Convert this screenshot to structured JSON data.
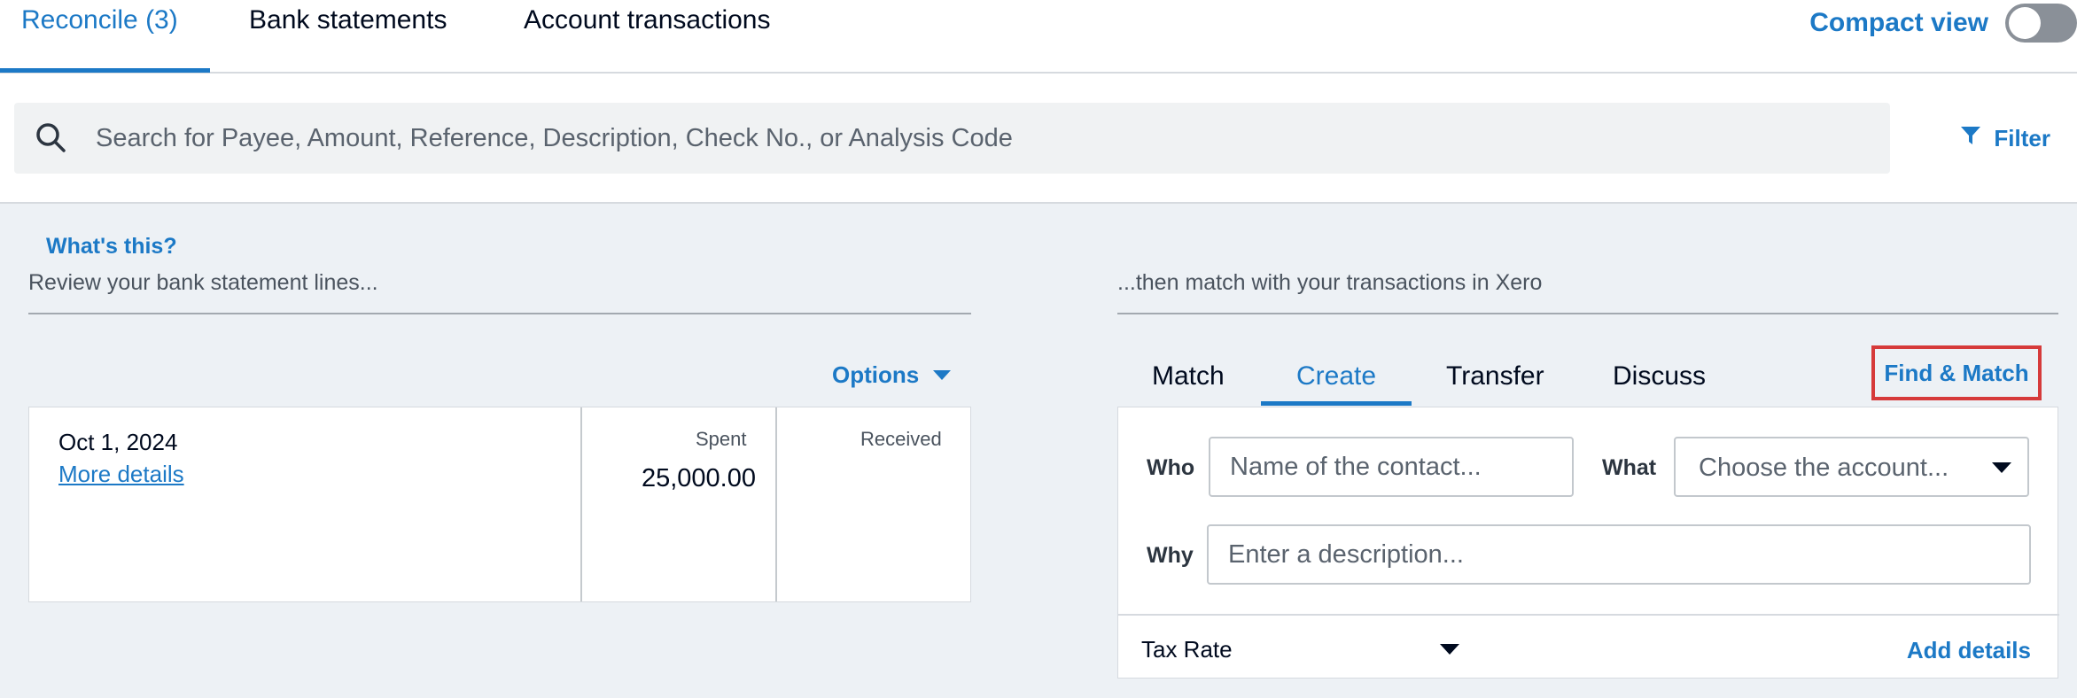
{
  "top_tabs": [
    {
      "label": "Reconcile (3)",
      "active": true
    },
    {
      "label": "Bank statements",
      "active": false
    },
    {
      "label": "Account transactions",
      "active": false
    }
  ],
  "compact_view": {
    "label": "Compact view",
    "enabled": false
  },
  "search": {
    "placeholder": "Search for Payee, Amount, Reference, Description, Check No., or Analysis Code",
    "icon": "search-icon"
  },
  "filter": {
    "label": "Filter",
    "icon": "funnel-icon"
  },
  "help": {
    "whats_this": "What's this?"
  },
  "captions": {
    "left": "Review your bank statement lines...",
    "right": "...then match with your transactions in Xero"
  },
  "options": {
    "label": "Options"
  },
  "statement_line": {
    "date": "Oct 1, 2024",
    "more_details": "More details",
    "spent_label": "Spent",
    "spent_value": "25,000.00",
    "received_label": "Received",
    "received_value": ""
  },
  "match_tabs": [
    {
      "label": "Match",
      "active": false
    },
    {
      "label": "Create",
      "active": true
    },
    {
      "label": "Transfer",
      "active": false
    },
    {
      "label": "Discuss",
      "active": false
    }
  ],
  "find_match": {
    "label": "Find & Match"
  },
  "create_form": {
    "who_label": "Who",
    "who_placeholder": "Name of the contact...",
    "what_label": "What",
    "what_placeholder": "Choose the account...",
    "why_label": "Why",
    "why_placeholder": "Enter a description...",
    "tax_rate_label": "Tax Rate",
    "add_details": "Add details"
  },
  "colors": {
    "accent": "#1c79c6",
    "highlight": "#d63a3a",
    "background": "#edf1f5"
  }
}
